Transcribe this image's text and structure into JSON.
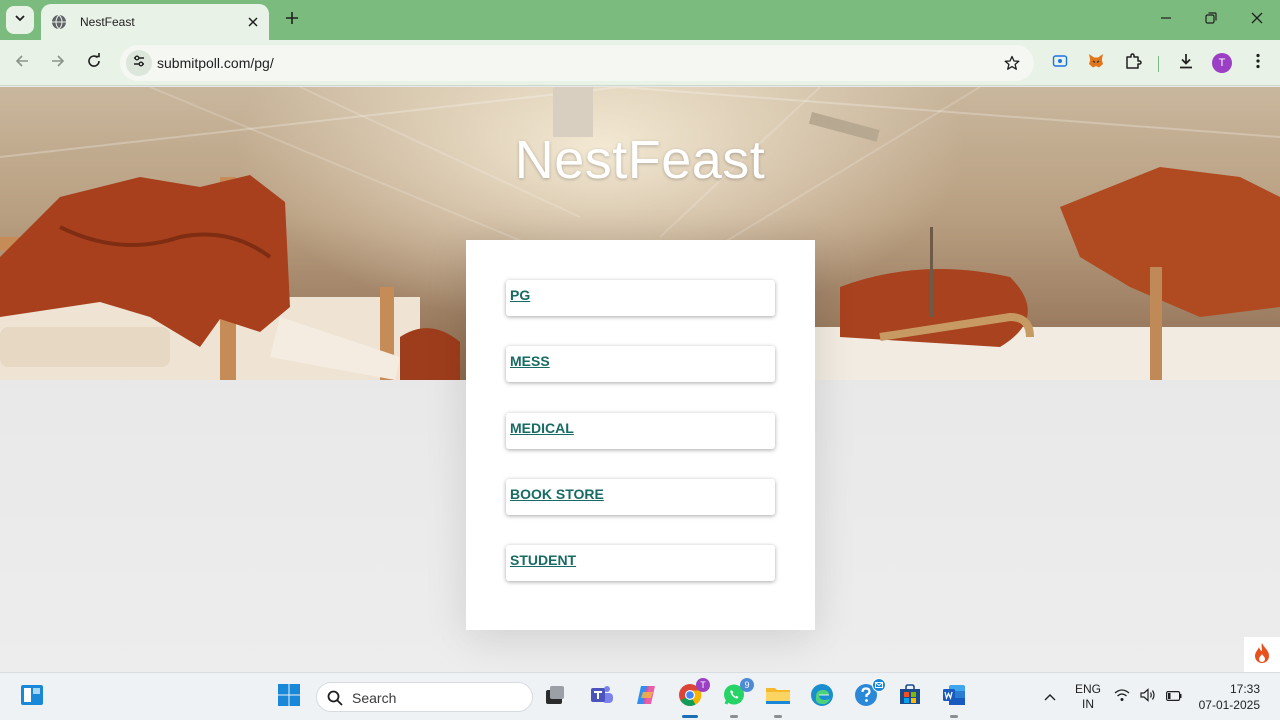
{
  "browser": {
    "tab_title": "NestFeast",
    "url": "submitpoll.com/pg/",
    "theme_color": "#7cbb7e",
    "profile_initial": "T"
  },
  "page": {
    "site_title": "NestFeast",
    "link_color": "#176b63",
    "nav_links": [
      {
        "label": "PG"
      },
      {
        "label": "MESS"
      },
      {
        "label": "MEDICAL"
      },
      {
        "label": "BOOK STORE"
      },
      {
        "label": "STUDENT"
      }
    ]
  },
  "taskbar": {
    "search_placeholder": "Search",
    "chrome_badge": "T",
    "whatsapp_badge": "9",
    "language_line1": "ENG",
    "language_line2": "IN",
    "time": "17:33",
    "date": "07-01-2025"
  },
  "icons": [
    "tab-search-icon",
    "globe-icon",
    "close-icon",
    "plus-icon",
    "minimize-icon",
    "restore-icon",
    "back-icon",
    "forward-icon",
    "reload-icon",
    "site-info-icon",
    "star-icon",
    "screen-capture-icon",
    "metamask-icon",
    "extensions-icon",
    "download-icon",
    "kebab-menu-icon",
    "fire-icon",
    "widgets-icon",
    "windows-start-icon",
    "search-icon",
    "task-view-icon",
    "teams-icon",
    "copilot-icon",
    "chrome-icon",
    "whatsapp-icon",
    "file-explorer-icon",
    "edge-icon",
    "help-icon",
    "store-icon",
    "word-icon",
    "chevron-up-icon",
    "wifi-icon",
    "volume-icon",
    "battery-icon"
  ]
}
